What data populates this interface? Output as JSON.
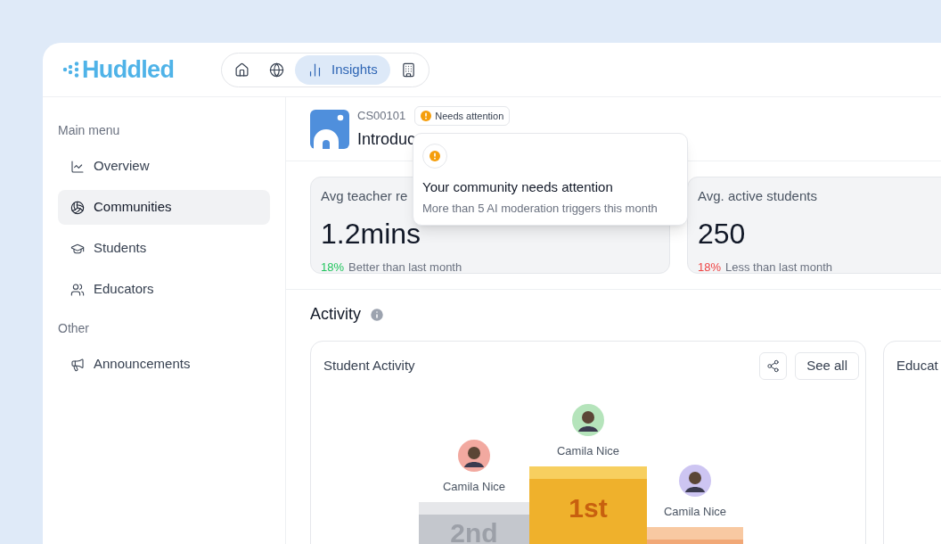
{
  "logo": "Huddled",
  "nav": [
    {
      "kind": "home",
      "selected": false
    },
    {
      "kind": "globe",
      "selected": false
    },
    {
      "kind": "insights",
      "label": "Insights",
      "selected": true
    },
    {
      "kind": "building",
      "selected": false
    }
  ],
  "sidebar": [
    {
      "heading": "Main menu",
      "items": [
        {
          "kind": "chart",
          "label": "Overview",
          "selected": false
        },
        {
          "kind": "ball",
          "label": "Communities",
          "selected": true
        },
        {
          "kind": "cap",
          "label": "Students",
          "selected": false
        },
        {
          "kind": "users",
          "label": "Educators",
          "selected": false
        }
      ]
    },
    {
      "heading": "Other",
      "items": [
        {
          "kind": "megaphone",
          "label": "Announcements",
          "selected": false
        }
      ]
    }
  ],
  "community": {
    "code": "CS00101",
    "title": "Introduc",
    "badge": "Needs attention",
    "tooltip": {
      "title": "Your community needs attention",
      "text": "More than 5 AI moderation triggers this month"
    }
  },
  "stats": [
    {
      "label": "Avg teacher re",
      "value": "1.2mins",
      "change": "18%",
      "kind": "up",
      "note": "Better than last month"
    },
    {
      "label": "Avg. active students",
      "value": "250",
      "change": "18%",
      "kind": "down",
      "note": "Less than last month"
    }
  ],
  "activity": {
    "title": "Activity",
    "cards": [
      {
        "title": "Student Activity",
        "button": "See all",
        "podium": [
          {
            "kind": "second",
            "name": "Camila Nice",
            "place": "2nd",
            "color": "#f2a9a0"
          },
          {
            "kind": "first",
            "name": "Camila Nice",
            "place": "1st",
            "color": "#b5e4bb"
          },
          {
            "kind": "third",
            "name": "Camila Nice",
            "color": "#cdc5f2"
          }
        ]
      },
      {
        "title": "Educat"
      }
    ]
  }
}
